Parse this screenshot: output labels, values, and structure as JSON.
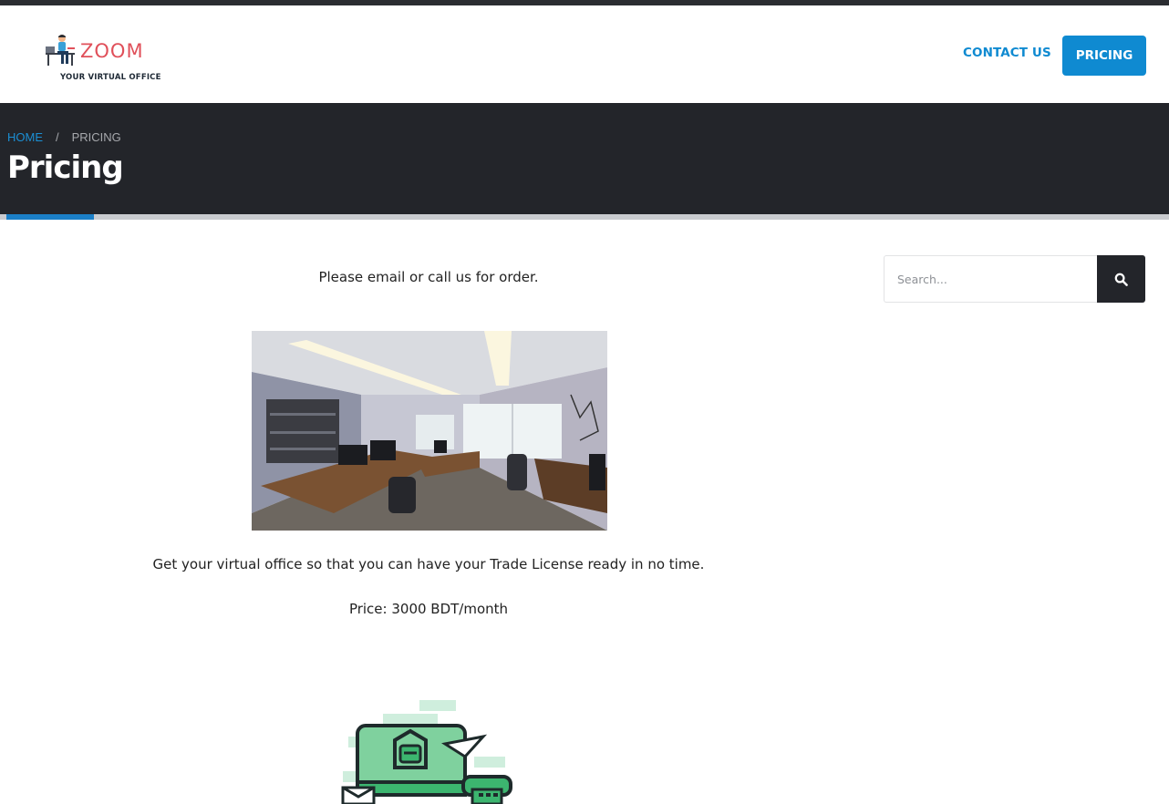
{
  "brand": {
    "name": "ZOOM",
    "tagline": "YOUR VIRTUAL OFFICE"
  },
  "nav": {
    "contact_label": "CONTACT US",
    "pricing_label": "PRICING"
  },
  "breadcrumb": {
    "home": "HOME",
    "separator": "/",
    "current": "PRICING"
  },
  "page": {
    "title": "Pricing",
    "reading_progress_percent": 7.5
  },
  "content": {
    "intro": "Please email or call us for order.",
    "description": "Get your virtual office so that you can have your Trade License ready in no time.",
    "price": "Price: 3000 BDT/month"
  },
  "search": {
    "placeholder": "Search...",
    "value": ""
  },
  "icons": {
    "search": "search-icon",
    "logo_figure": "person-at-desk-icon"
  },
  "colors": {
    "accent": "#0f8ad1",
    "banner": "#23252a",
    "logo_text": "#e0505a",
    "illustration_green": "#3cb56f"
  }
}
